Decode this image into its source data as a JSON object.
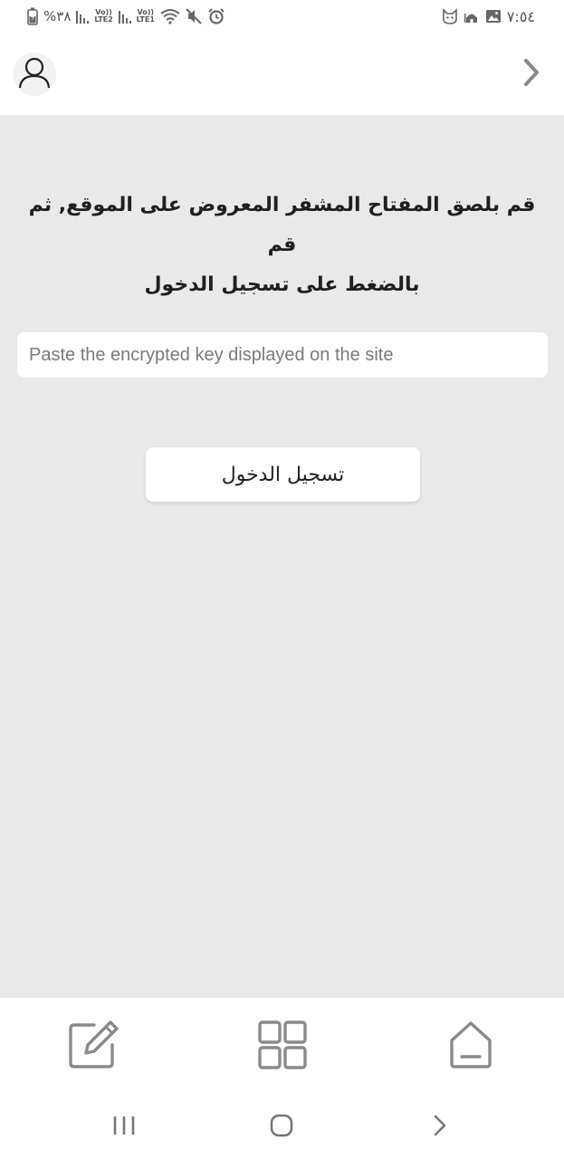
{
  "status_bar": {
    "time": "٧:٥٤",
    "battery_percent": "%٣٨",
    "network_1": {
      "top": "Vo))",
      "bottom": "LTE2"
    },
    "network_2": {
      "top": "Vo))",
      "bottom": "LTE1"
    },
    "icons_left": [
      "battery-icon",
      "signal-icon",
      "signal-icon",
      "wifi-icon",
      "mute-icon",
      "alarm-icon"
    ],
    "icons_right": [
      "cat-app-icon",
      "mosque-app-icon",
      "image-icon"
    ]
  },
  "header": {
    "avatar_icon": "user-icon",
    "forward_icon": "chevron-right-icon"
  },
  "main": {
    "instruction_line1": "قم بلصق المفتاح المشفر المعروض على الموقع, ثم قم",
    "instruction_line2": "بالضغط على تسجيل الدخول",
    "key_input": {
      "value": "",
      "placeholder": "Paste the encrypted key displayed on the site"
    },
    "login_label": "تسجيل الدخول"
  },
  "bottom_nav": {
    "items": [
      {
        "icon": "edit-icon"
      },
      {
        "icon": "grid-icon"
      },
      {
        "icon": "home-icon"
      }
    ]
  },
  "system_nav": {
    "items": [
      "recent-apps-icon",
      "home-circle-icon",
      "back-icon"
    ]
  },
  "colors": {
    "background_main": "#e9e9e9",
    "surface": "#ffffff",
    "icon_gray": "#8a8a8a",
    "text_dark": "#1f1f1f"
  }
}
